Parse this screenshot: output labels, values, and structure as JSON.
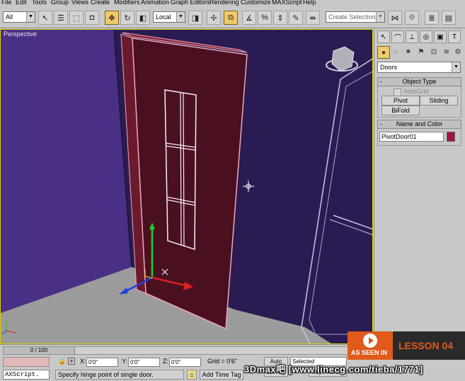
{
  "menubar": {
    "items": [
      "File",
      "Edit",
      "Tools",
      "Group",
      "Views",
      "Create",
      "Modifiers",
      "Animation",
      "Graph Editors",
      "Rendering",
      "Customize",
      "MAXScript",
      "Help"
    ]
  },
  "toolbar": {
    "selection_filter": "All",
    "ref_coord_system": "Local",
    "named_selection_placeholder": "Create Selection Set"
  },
  "viewport": {
    "label": "Perspective"
  },
  "command_panel": {
    "category_dropdown": "Doors",
    "object_type": {
      "title": "Object Type",
      "sign": "-",
      "autogrid_label": "AutoGrid",
      "buttons": [
        "Pivot",
        "Sliding",
        "BiFold"
      ]
    },
    "name_and_color": {
      "title": "Name and Color",
      "sign": "-",
      "object_name": "PivotDoor01",
      "color": "#a01840"
    }
  },
  "status": {
    "time_slider": "0 / 100",
    "x_label": "X:",
    "x_value": "0'0\"",
    "y_label": "Y:",
    "y_value": "0'0\"",
    "z_label": "Z:",
    "z_value": "0'0\"",
    "grid": "Grid = 0'6\"",
    "auto_key": "Auto Key",
    "set_key": "Set Key",
    "key_mode": "Selected",
    "key_filters": "Key Filters...",
    "add_time_tag": "Add Time Tag",
    "prompt": "Specify hinge point of single door.",
    "maxscript": "AXScript."
  },
  "overlay": {
    "as_seen_in": "AS SEEN IN",
    "lesson": "LESSON 04",
    "watermark": "3Dmax吧  [www.linecg.com/tieba/1771]",
    "accent": "#e05a1a"
  }
}
